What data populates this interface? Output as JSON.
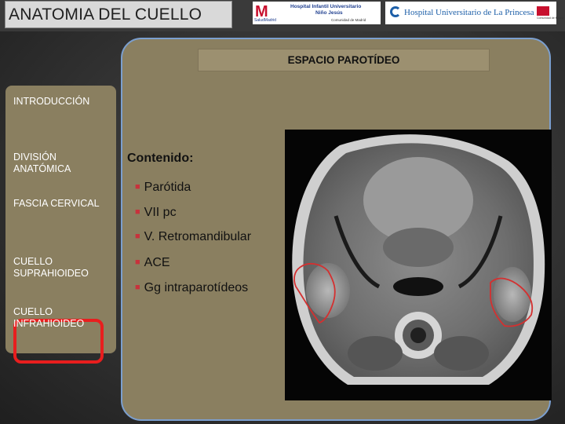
{
  "header": {
    "title": "ANATOMIA DEL CUELLO",
    "logo_nino_jesus": {
      "mark": "M",
      "line1": "Hospital Infantil Universitario",
      "line2": "Niño Jesús",
      "line3": "Comunidad de Madrid",
      "sub": "SaludMadrid"
    },
    "logo_princesa": {
      "name": "Hospital Universitario de La Princesa",
      "sub": "Comunidad de Madrid"
    }
  },
  "section_header": "ESPACIO PAROTÍDEO",
  "nav": {
    "items": [
      {
        "label": "INTRODUCCIÓN",
        "selected": false
      },
      {
        "label": "DIVISIÓN\nANATÓMICA",
        "selected": false
      },
      {
        "label": "FASCIA CERVICAL",
        "selected": false
      },
      {
        "label": "CUELLO\nSUPRAHIOIDEO",
        "selected": true
      },
      {
        "label": "CUELLO\nINFRAHIOIDEO",
        "selected": false
      }
    ]
  },
  "content": {
    "heading": "Contenido:",
    "bullets": [
      "Parótida",
      "VII pc",
      "V. Retromandibular",
      "ACE",
      "Gg intraparotídeos"
    ]
  },
  "image": {
    "description_icon": "mri-axial-neck-icon",
    "annotation_color": "#d43030"
  },
  "colors": {
    "panel": "#8a7f60",
    "highlight": "#e81e1e",
    "border_blue": "#7b9fcf",
    "bullet": "#c8323c"
  }
}
